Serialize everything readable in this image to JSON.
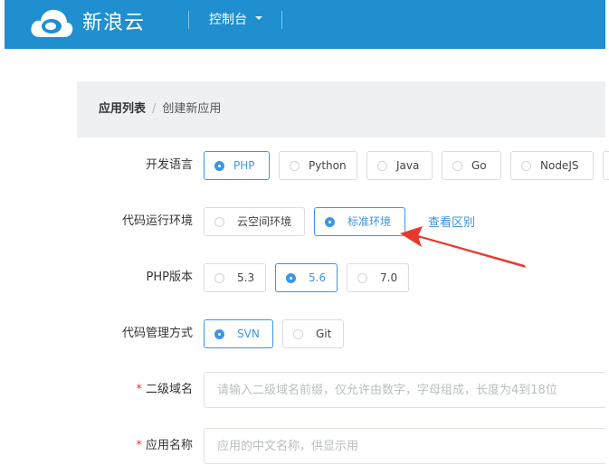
{
  "header": {
    "brand": "新浪云",
    "console_label": "控制台"
  },
  "breadcrumb": {
    "parent": "应用列表",
    "separator": "/",
    "current": "创建新应用"
  },
  "form": {
    "language": {
      "label": "开发语言",
      "options": [
        "PHP",
        "Python",
        "Java",
        "Go",
        "NodeJS"
      ],
      "selected": "PHP"
    },
    "runtime": {
      "label": "代码运行环境",
      "options": [
        "云空间环境",
        "标准环境"
      ],
      "selected": "标准环境",
      "help_link": "查看区别"
    },
    "php_version": {
      "label": "PHP版本",
      "options": [
        "5.3",
        "5.6",
        "7.0"
      ],
      "selected": "5.6"
    },
    "vcs": {
      "label": "代码管理方式",
      "options": [
        "SVN",
        "Git"
      ],
      "selected": "SVN"
    },
    "subdomain": {
      "required_mark": "*",
      "label": "二级域名",
      "value": "",
      "placeholder": "请输入二级域名前缀，仅允许由数字，字母组成，长度为4到18位"
    },
    "app_name": {
      "required_mark": "*",
      "label": "应用名称",
      "value": "",
      "placeholder": "应用的中文名称，供显示用"
    }
  },
  "colors": {
    "header_bg": "#1f8fd0",
    "accent": "#3d95e3",
    "annotation_arrow": "#e8392f"
  },
  "icons": {
    "logo": "cloud-logo-icon",
    "dropdown": "caret-down-icon"
  }
}
